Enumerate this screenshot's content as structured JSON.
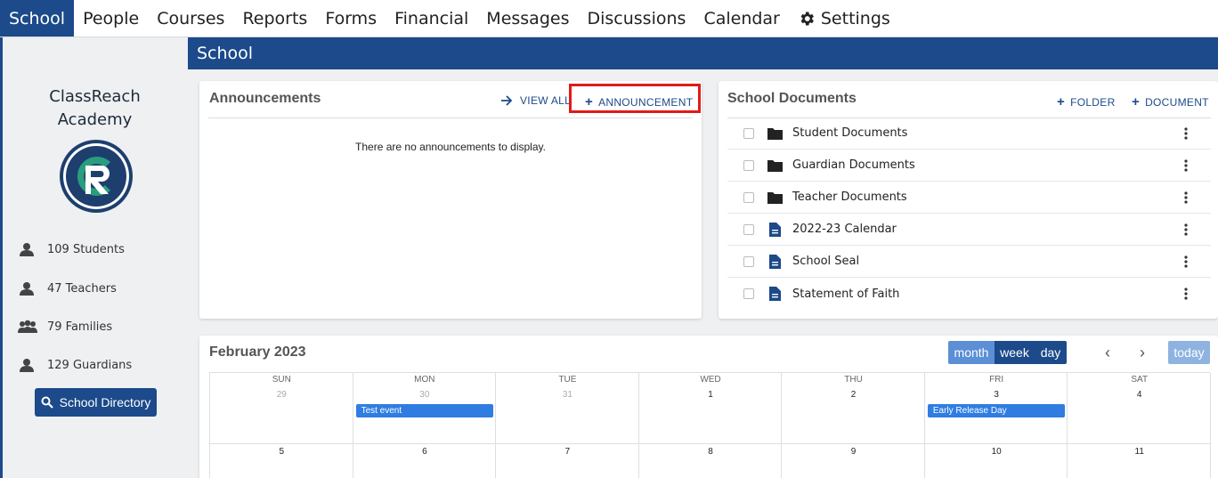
{
  "nav": {
    "items": [
      "School",
      "People",
      "Courses",
      "Reports",
      "Forms",
      "Financial",
      "Messages",
      "Discussions",
      "Calendar",
      "Settings"
    ],
    "active": "School",
    "settings_icon": "gear-icon"
  },
  "page": {
    "title": "School"
  },
  "sidebar": {
    "school_name_line1": "ClassReach",
    "school_name_line2": "Academy",
    "stats": [
      {
        "icon": "person-icon",
        "label": "109 Students"
      },
      {
        "icon": "person-icon",
        "label": "47 Teachers"
      },
      {
        "icon": "family-icon",
        "label": "79 Families"
      },
      {
        "icon": "person-icon",
        "label": "129 Guardians"
      }
    ],
    "directory_button": "School Directory",
    "directory_icon": "search-icon"
  },
  "announcements": {
    "title": "Announcements",
    "view_all": "VIEW ALL",
    "add": "ANNOUNCEMENT",
    "empty_message": "There are no announcements to display."
  },
  "documents": {
    "title": "School Documents",
    "add_folder": "FOLDER",
    "add_document": "DOCUMENT",
    "items": [
      {
        "name": "Student Documents",
        "type": "folder"
      },
      {
        "name": "Guardian Documents",
        "type": "folder"
      },
      {
        "name": "Teacher Documents",
        "type": "folder"
      },
      {
        "name": "2022-23 Calendar",
        "type": "file"
      },
      {
        "name": "School Seal",
        "type": "file"
      },
      {
        "name": "Statement of Faith",
        "type": "file"
      }
    ]
  },
  "calendar": {
    "title": "February 2023",
    "views": [
      "month",
      "week",
      "day"
    ],
    "active_view": "week",
    "prev": "‹",
    "next": "›",
    "today": "today",
    "days_of_week": [
      "SUN",
      "MON",
      "TUE",
      "WED",
      "THU",
      "FRI",
      "SAT"
    ],
    "week1": [
      "29",
      "30",
      "31",
      "1",
      "2",
      "3",
      "4"
    ],
    "week1_other_month": [
      true,
      true,
      true,
      false,
      false,
      false,
      false
    ],
    "week2": [
      "5",
      "6",
      "7",
      "8",
      "9",
      "10",
      "11"
    ],
    "events": [
      {
        "day_index": 1,
        "label": "Test event"
      },
      {
        "day_index": 5,
        "label": "Early Release Day"
      }
    ]
  },
  "colors": {
    "brand": "#1c4a8a",
    "event": "#2f7de1",
    "highlight": "#e01a1a",
    "view_inactive": "#5b8fd6",
    "today_disabled": "#8fb3e0"
  }
}
